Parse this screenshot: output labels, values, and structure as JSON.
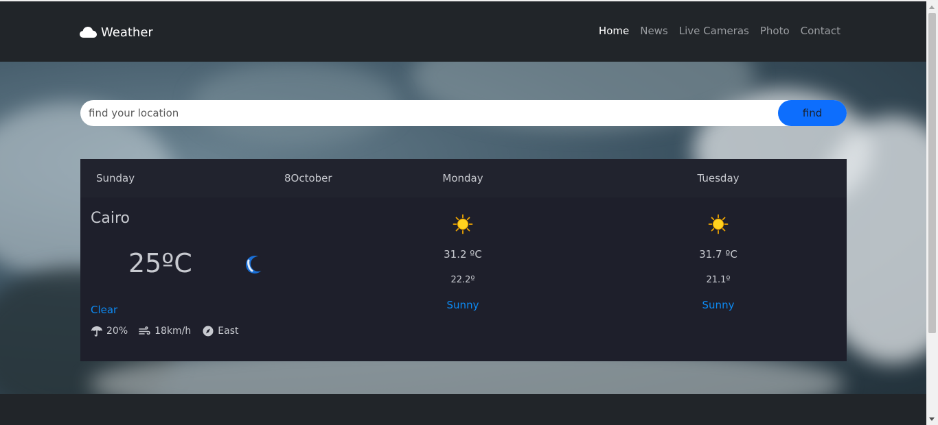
{
  "nav": {
    "brand": "Weather",
    "links": [
      "Home",
      "News",
      "Live Cameras",
      "Photo",
      "Contact"
    ],
    "active": "Home"
  },
  "search": {
    "placeholder": "find your location",
    "button_label": "find"
  },
  "today": {
    "day": "Sunday",
    "date": "8October",
    "city": "Cairo",
    "temp": "25ºC",
    "condition": "Clear",
    "rain": "20%",
    "wind": "18km/h",
    "direction": "East",
    "icon": "moon-icon"
  },
  "days": [
    {
      "day": "Monday",
      "max": "31.2 ºC",
      "min": "22.2º",
      "condition": "Sunny",
      "icon": "sun-icon"
    },
    {
      "day": "Tuesday",
      "max": "31.7 ºC",
      "min": "21.1º",
      "condition": "Sunny",
      "icon": "sun-icon"
    }
  ],
  "colors": {
    "navbar": "#212529",
    "card": "#1e1f2b",
    "accent": "#0d6efd",
    "condition_text": "#0d8bf5"
  }
}
